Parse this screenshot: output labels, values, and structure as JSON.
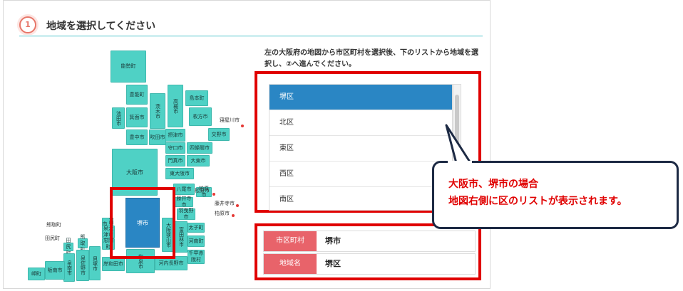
{
  "header": {
    "step_number": "1",
    "title": "地域を選択してください"
  },
  "instruction": "左の大阪府の地図から市区町村を選択後、下のリストから地域を選択し、②へ進んでください。",
  "map": {
    "municipalities": [
      "能勢町",
      "豊能町",
      "池田市",
      "箕面市",
      "茨木市",
      "高槻市",
      "島本町",
      "枚方市",
      "豊中市",
      "吹田市",
      "摂津市",
      "交野市",
      "守口市",
      "四條畷市",
      "門真市",
      "大東市",
      "大阪市",
      "東大阪市",
      "八尾市",
      "柏原市",
      "藤井寺市",
      "羽曳野市",
      "堺市",
      "高石市",
      "泉大津市",
      "忠岡町",
      "和泉市",
      "大阪狭山市",
      "富田林市",
      "太子町",
      "河南町",
      "千早赤阪村",
      "河内長野市",
      "岸和田市",
      "貝塚市",
      "熊取町",
      "泉佐野市",
      "田尻町",
      "泉南市",
      "阪南市",
      "岬町",
      "寝屋川市",
      "松原市"
    ],
    "callout_labels": [
      "寝屋川市",
      "松原市",
      "藤井寺市",
      "柏原市",
      "熊取町",
      "田尻町"
    ]
  },
  "district_list": {
    "items": [
      "堺区",
      "北区",
      "東区",
      "西区",
      "南区"
    ],
    "selected": "堺区"
  },
  "result": {
    "municipality_label": "市区町村",
    "municipality_value": "堺市",
    "area_label": "地域名",
    "area_value": "堺区"
  },
  "callout": {
    "line1": "大阪市、堺市の場合",
    "line2": "地図右側に区のリストが表示されます。"
  },
  "colors": {
    "accent": "#e00000",
    "map_fill": "#4fd1c5",
    "selected_fill": "#2a86c4",
    "header_cell": "#e8636a"
  }
}
